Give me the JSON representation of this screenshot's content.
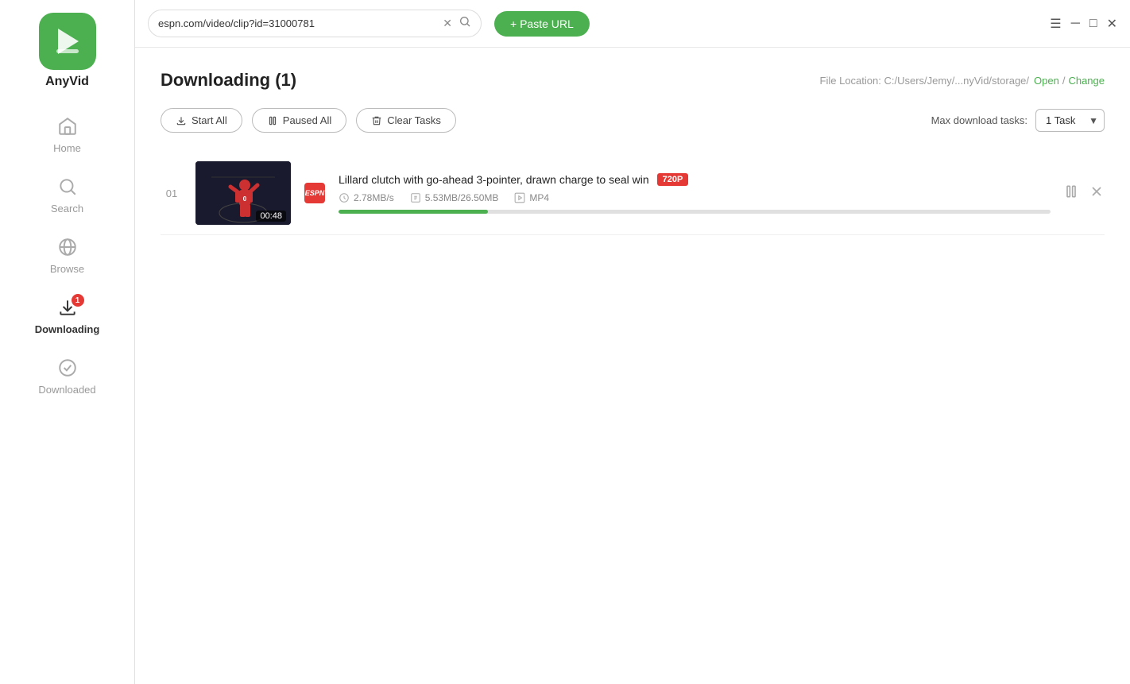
{
  "app": {
    "name": "AnyVid"
  },
  "titlebar": {
    "url": "espn.com/video/clip?id=31000781",
    "paste_btn_label": "+ Paste URL"
  },
  "window_controls": {
    "menu": "☰",
    "minimize": "─",
    "maximize": "□",
    "close": "✕"
  },
  "sidebar": {
    "items": [
      {
        "id": "home",
        "label": "Home",
        "active": false
      },
      {
        "id": "search",
        "label": "Search",
        "active": false
      },
      {
        "id": "browse",
        "label": "Browse",
        "active": false
      },
      {
        "id": "downloading",
        "label": "Downloading",
        "active": true,
        "badge": "1"
      },
      {
        "id": "downloaded",
        "label": "Downloaded",
        "active": false
      }
    ]
  },
  "content": {
    "page_title": "Downloading (1)",
    "file_location_label": "File Location: C:/Users/Jemy/...nyVid/storage/",
    "open_label": "Open",
    "change_label": "Change",
    "toolbar": {
      "start_all": "Start All",
      "paused_all": "Paused All",
      "clear_tasks": "Clear Tasks",
      "max_tasks_label": "Max download tasks:",
      "max_tasks_value": "1 Task"
    },
    "downloads": [
      {
        "number": "01",
        "title": "Lillard clutch with go-ahead 3-pointer, drawn charge to seal win",
        "quality": "720P",
        "speed": "2.78MB/s",
        "size_downloaded": "5.53MB",
        "size_total": "26.50MB",
        "format": "MP4",
        "timestamp": "00:48",
        "progress_percent": 21
      }
    ]
  }
}
